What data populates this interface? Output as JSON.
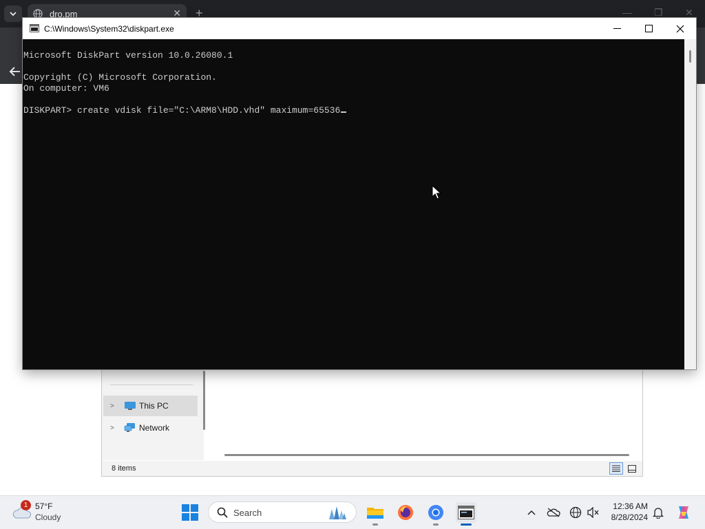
{
  "browser": {
    "tab_title": "dro.pm",
    "new_tab_symbol": "+"
  },
  "console": {
    "title": "C:\\Windows\\System32\\diskpart.exe",
    "lines": [
      "Microsoft DiskPart version 10.0.26080.1",
      "Copyright (C) Microsoft Corporation.",
      "On computer: VM6",
      "DISKPART> create vdisk file=\"C:\\ARM8\\HDD.vhd\" maximum=65536"
    ],
    "background_color": "#0c0c0c",
    "text_color": "#cccccc"
  },
  "explorer": {
    "nav_items": [
      {
        "label": "This PC",
        "icon": "this-pc-icon",
        "selected": true
      },
      {
        "label": "Network",
        "icon": "network-icon",
        "selected": false
      }
    ],
    "status_text": "8 items"
  },
  "taskbar": {
    "weather": {
      "temp": "57°F",
      "condition": "Cloudy",
      "badge": "1"
    },
    "search_placeholder": "Search",
    "apps": [
      "file-explorer-icon",
      "firefox-icon",
      "chrome-icon",
      "terminal-icon"
    ],
    "clock": {
      "time": "12:36 AM",
      "date": "8/28/2024"
    },
    "accent_color": "#005fb8"
  }
}
